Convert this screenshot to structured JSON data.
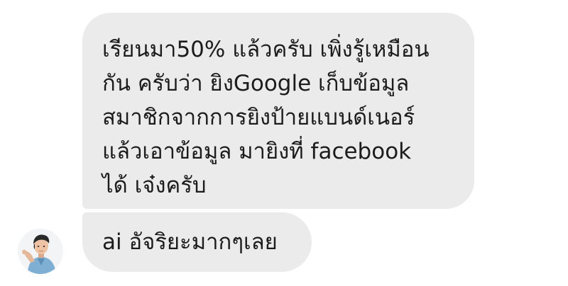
{
  "conversation": {
    "messages": [
      {
        "lines": [
          "เรียนมา50% แล้วครับ  เพิ่งรู้เหมือน",
          "กัน ครับว่า  ยิงGoogle เก็บข้อมูล",
          "สมาชิกจากการยิงป้ายแบนด์เนอร์",
          "แล้วเอาข้อมูล มายิงที่ facebook",
          "ได้  เจ๋งครับ"
        ]
      },
      {
        "lines": [
          "ai อัจริยะมากๆเลย"
        ]
      }
    ],
    "sender": {
      "avatar_icon": "user-avatar-photo"
    }
  }
}
